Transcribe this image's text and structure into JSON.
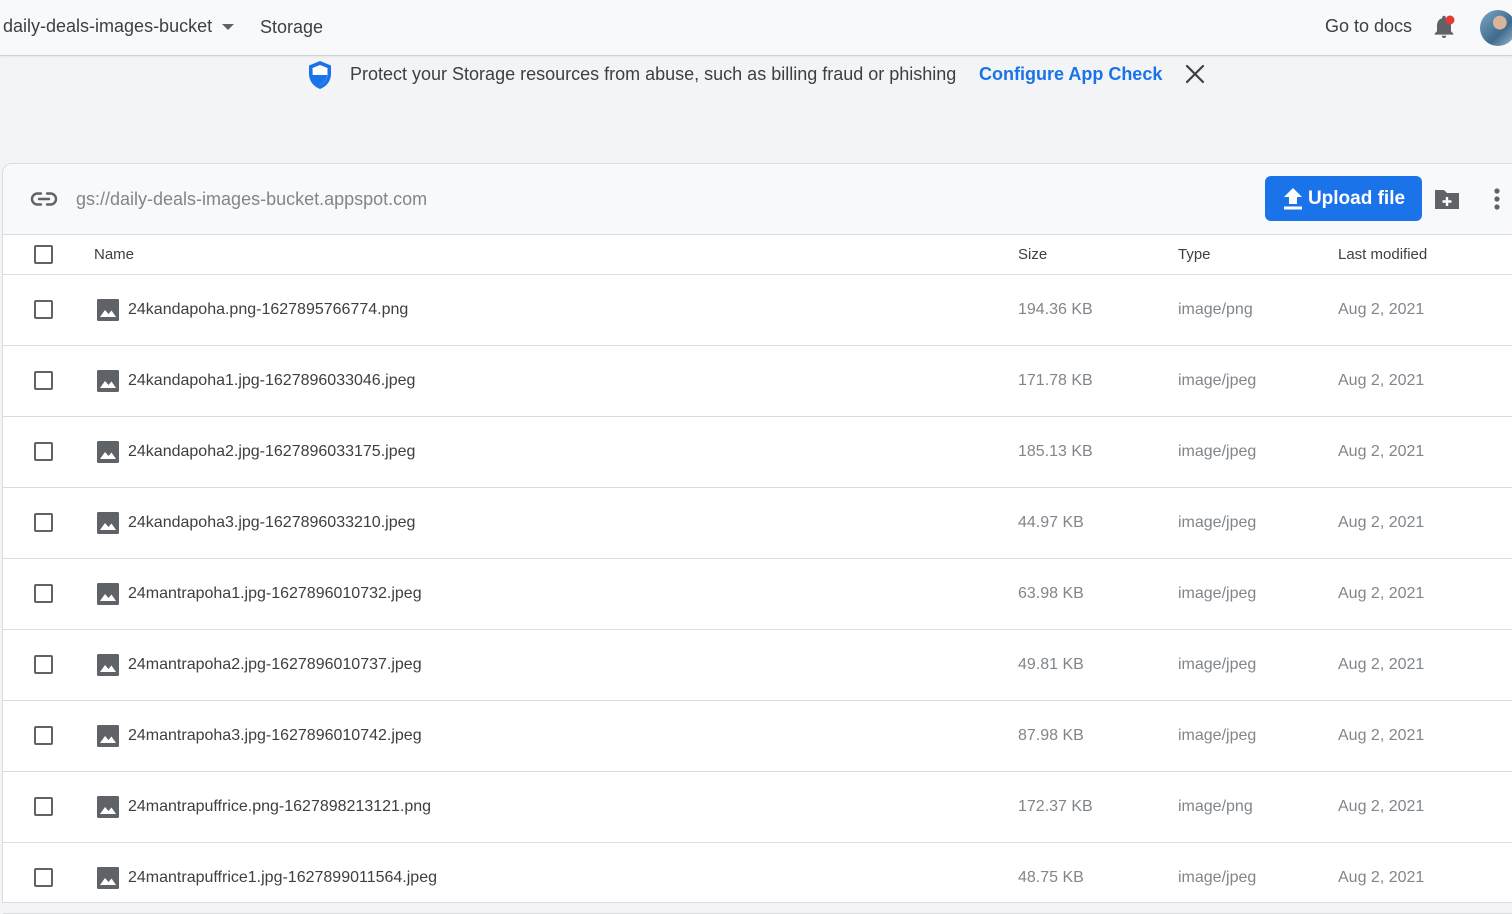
{
  "topbar": {
    "bucket_name": "daily-deals-images-bucket",
    "breadcrumb": "Storage",
    "go_to_docs": "Go to docs"
  },
  "banner": {
    "message": "Protect your Storage resources from abuse, such as billing fraud or phishing",
    "cta": "Configure App Check"
  },
  "storage": {
    "path": "gs://daily-deals-images-bucket.appspot.com",
    "upload_label": "Upload file"
  },
  "table": {
    "columns": {
      "name": "Name",
      "size": "Size",
      "type": "Type",
      "modified": "Last modified"
    },
    "rows": [
      {
        "name": "24kandapoha.png-1627895766774.png",
        "size": "194.36 KB",
        "type": "image/png",
        "modified": "Aug 2, 2021"
      },
      {
        "name": "24kandapoha1.jpg-1627896033046.jpeg",
        "size": "171.78 KB",
        "type": "image/jpeg",
        "modified": "Aug 2, 2021"
      },
      {
        "name": "24kandapoha2.jpg-1627896033175.jpeg",
        "size": "185.13 KB",
        "type": "image/jpeg",
        "modified": "Aug 2, 2021"
      },
      {
        "name": "24kandapoha3.jpg-1627896033210.jpeg",
        "size": "44.97 KB",
        "type": "image/jpeg",
        "modified": "Aug 2, 2021"
      },
      {
        "name": "24mantrapoha1.jpg-1627896010732.jpeg",
        "size": "63.98 KB",
        "type": "image/jpeg",
        "modified": "Aug 2, 2021"
      },
      {
        "name": "24mantrapoha2.jpg-1627896010737.jpeg",
        "size": "49.81 KB",
        "type": "image/jpeg",
        "modified": "Aug 2, 2021"
      },
      {
        "name": "24mantrapoha3.jpg-1627896010742.jpeg",
        "size": "87.98 KB",
        "type": "image/jpeg",
        "modified": "Aug 2, 2021"
      },
      {
        "name": "24mantrapuffrice.png-1627898213121.png",
        "size": "172.37 KB",
        "type": "image/png",
        "modified": "Aug 2, 2021"
      },
      {
        "name": "24mantrapuffrice1.jpg-1627899011564.jpeg",
        "size": "48.75 KB",
        "type": "image/jpeg",
        "modified": "Aug 2, 2021"
      }
    ]
  },
  "colors": {
    "accent": "#1a73e8",
    "text": "#3c4043",
    "muted": "#80868b",
    "icon": "#5f6368",
    "notification_dot": "#e53935"
  },
  "icons": [
    "dropdown-caret-icon",
    "bell-icon",
    "shield-icon",
    "close-icon",
    "link-icon",
    "upload-icon",
    "new-folder-icon",
    "more-vert-icon",
    "image-file-icon"
  ]
}
